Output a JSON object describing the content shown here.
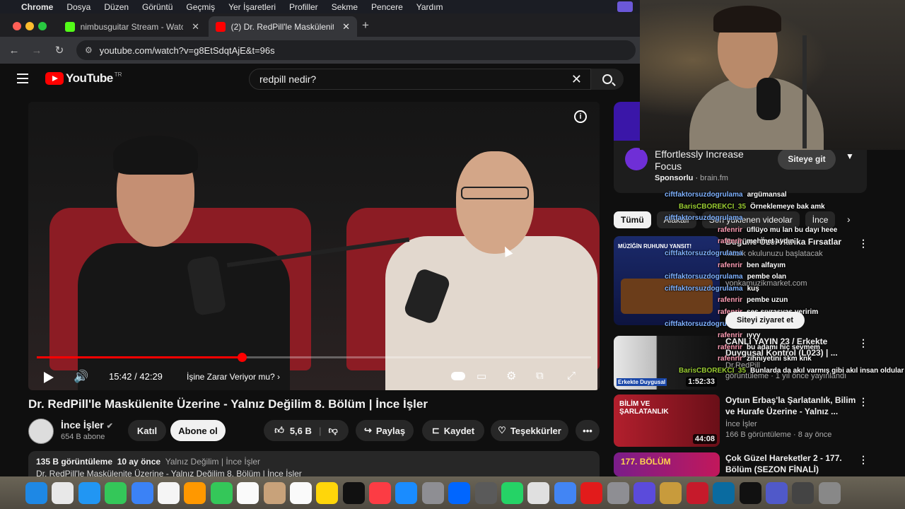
{
  "mac_menu": {
    "apple": "",
    "items": [
      "Chrome",
      "Dosya",
      "Düzen",
      "Görüntü",
      "Geçmiş",
      "Yer İşaretleri",
      "Profiller",
      "Sekme",
      "Pencere",
      "Yardım"
    ]
  },
  "tabs": [
    {
      "title": "nimbusguitar Stream - Watch",
      "favicon_color": "#53fc18"
    },
    {
      "title": "(2) Dr. RedPill'le Maskülenite",
      "favicon_color": "#ff0000"
    }
  ],
  "url": "youtube.com/watch?v=g8EtSdqtAjE&t=96s",
  "youtube": {
    "logo": "YouTube",
    "country": "TR",
    "search_value": "redpill nedir?",
    "player": {
      "time": "15:42 / 42:29",
      "chapter": "İşine Zarar Veriyor mu?",
      "progress": 0.37
    },
    "video_title": "Dr. RedPill'le Maskülenite Üzerine - Yalnız Değilim 8. Bölüm | İnce İşler",
    "channel": {
      "name": "İnce İşler",
      "subs": "654 B abone"
    },
    "buttons": {
      "join": "Katıl",
      "subscribe": "Abone ol",
      "likes": "5,6 B",
      "share": "Paylaş",
      "save": "Kaydet",
      "thanks": "Teşekkürler"
    },
    "description": {
      "views": "135 B görüntüleme",
      "age": "10 ay önce",
      "tags": "Yalnız Değilim | İnce İşler",
      "line": "Dr. RedPill'le Maskülenite Üzerine - Yalnız Değilim 8. Bölüm | İnce İşler"
    }
  },
  "sidebar": {
    "ad": {
      "title": "Effortlessly Increase Focus",
      "sponsor": "Sponsorlu",
      "domain": "brain.fm",
      "cta": "Siteye git"
    },
    "chips": [
      "Tümü",
      "Alakalı",
      "Son yüklenen videolar",
      "İnce"
    ],
    "recs": [
      {
        "title": "Buğüne Özel Harika Fırsatlar",
        "channel": "yonkamuzikmarket.com",
        "meta": "Müzik okulunuzu başlatacak",
        "thumb_text": "MÜZİĞİN RUHUNU YANSIT!",
        "cta": "Siteyi ziyaret et"
      },
      {
        "title": "CANLI YAYIN 23 / Erkekte Duygusal Kontrol (L023) | ...",
        "channel": "Dr.RedPill",
        "meta": "görüntüleme · 1 yıl önce yayınlandı",
        "duration": "1:52:33",
        "thumb_text": "Erkekte Duygusal"
      },
      {
        "title": "Oytun Erbaş'la Şarlatanlık, Bilim ve Hurafe Üzerine - Yalnız ...",
        "channel": "İnce İşler",
        "meta": "166 B görüntüleme · 8 ay önce",
        "duration": "44:08",
        "thumb_text": "BİLİM VE ŞARLATANLIK"
      },
      {
        "title": "Çok Güzel Hareketler 2 - 177. Bölüm (SEZON FİNALİ)",
        "channel": "",
        "meta": "",
        "thumb_text": "177. BÖLÜM"
      }
    ]
  },
  "chat": [
    {
      "user": "ciftfaktorsuzdogrulama",
      "msg": "argümansal",
      "color": "#7fb2ff"
    },
    {
      "user": "BarisCBOREKCI_35",
      "msg": "Örneklemeye bak amk",
      "color": "#9acd32"
    },
    {
      "user": "ciftfaktorsuzdogrulama",
      "msg": "",
      "color": "#7fb2ff"
    },
    {
      "user": "rafenrir",
      "msg": "üflüyo mu lan bu dayı heee",
      "color": "#ff9eb5"
    },
    {
      "user": "rafenrir",
      "msg": "mehmet aydın",
      "color": "#ff9eb5"
    },
    {
      "user": "ciftfaktorsuzdogrulama",
      "msg": "",
      "color": "#7fb2ff"
    },
    {
      "user": "rafenrir",
      "msg": "ben alfayım",
      "color": "#ff9eb5"
    },
    {
      "user": "ciftfaktorsuzdogrulama",
      "msg": "pembe olan",
      "color": "#7fb2ff"
    },
    {
      "user": "ciftfaktorsuzdogrulama",
      "msg": "kuş",
      "color": "#7fb2ff"
    },
    {
      "user": "rafenrir",
      "msg": "pembe uzun",
      "color": "#ff9eb5"
    },
    {
      "user": "rafenrir",
      "msg": "ses sıyrasyaş veririm",
      "color": "#ff9eb5"
    },
    {
      "user": "ciftfaktorsuzdogrulama",
      "msg": "aha",
      "color": "#7fb2ff"
    },
    {
      "user": "rafenrir",
      "msg": "ıyyy",
      "color": "#ff9eb5"
    },
    {
      "user": "rafenrir",
      "msg": "bu adamı hiç sevmem",
      "color": "#ff9eb5"
    },
    {
      "user": "rafenrir",
      "msg": "zihniyetini skm knk",
      "color": "#ff9eb5"
    },
    {
      "user": "BarisCBOREKCI_35",
      "msg": "Bunlarda da akıl varmış gibi akıl insan oldular",
      "color": "#9acd32"
    }
  ],
  "dock": [
    "#1e88e5",
    "#e8e8e8",
    "#2196f3",
    "#34c759",
    "#3b82f6",
    "#f5f5f5",
    "#ff9800",
    "#34c759",
    "#fafafa",
    "#c8a27a",
    "#fafafa",
    "#ffd60a",
    "#111111",
    "#fc3c44",
    "#1a8cff",
    "#8e8e93",
    "#0066ff",
    "#5a5a5a",
    "#25d366",
    "#e0e0e0",
    "#4285f4",
    "#e21b1b",
    "#8e8e93",
    "#5b4bdb",
    "#c89b3c",
    "#c61a2b",
    "#0a6ba0",
    "#111111",
    "#5059c9",
    "#444444",
    "#888888"
  ]
}
